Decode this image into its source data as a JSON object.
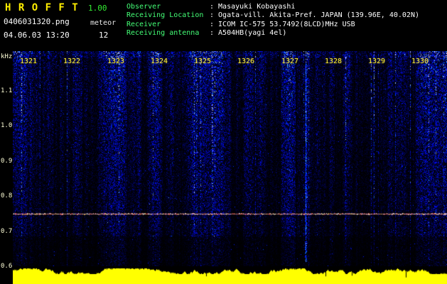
{
  "colors": {
    "background": "#000000",
    "title_yellow": "#ffee00",
    "version_green": "#33ee33",
    "info_label_green": "#44ff77",
    "value_white": "#ffffff",
    "time_label_yellow": "#ffee33",
    "freq_label": "#ffffd8",
    "bar_yellow": "#ffff00",
    "carrier_line": "#ff9977"
  },
  "app": {
    "title": "H R O F F T",
    "version": "1.00",
    "filename": "0406031320.png",
    "mode": "meteor",
    "count": "12",
    "datetime": "04.06.03 13:20"
  },
  "info": {
    "rows": [
      {
        "label": "Observer",
        "value": "Masayuki Kobayashi"
      },
      {
        "label": "Receiving Location",
        "value": "Ogata-vill. Akita-Pref. JAPAN (139.96E, 40.02N)"
      },
      {
        "label": "Receiver",
        "value": "ICOM IC-575 53.7492(8LCD)MHz USB"
      },
      {
        "label": "Receiving antenna",
        "value": "A504HB(yagi 4el)"
      }
    ]
  },
  "spectrogram": {
    "freq_unit": "kHz",
    "freq_labels": [
      "1.1",
      "1.0",
      "0.9",
      "0.8",
      "0.7",
      "0.6"
    ],
    "freq_range_khz": [
      0.6,
      1.15
    ],
    "time_labels": [
      "1321",
      "1322",
      "1323",
      "1324",
      "1325",
      "1326",
      "1327",
      "1328",
      "1329",
      "1330"
    ],
    "carrier_freq_khz": 0.75
  }
}
